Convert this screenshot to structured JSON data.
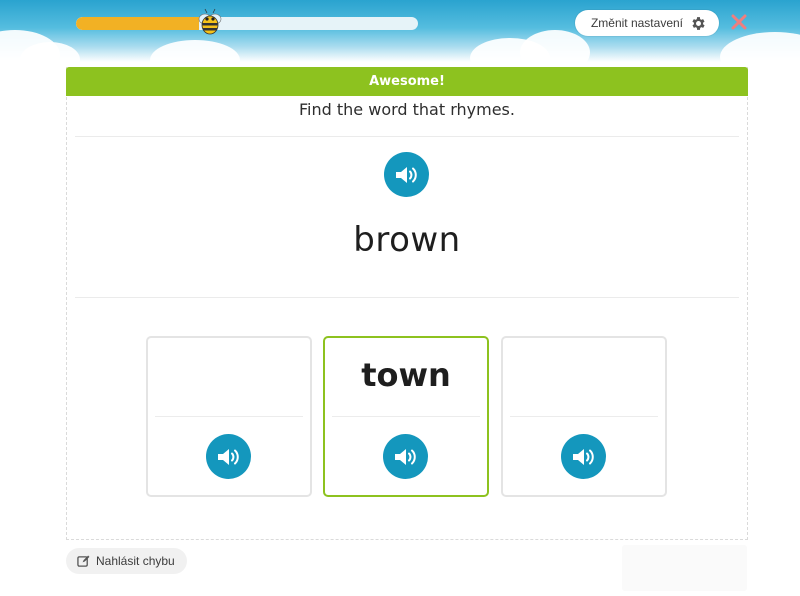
{
  "header": {
    "progress_fraction": 0.36,
    "settings_label": "Změnit nastavení",
    "colors": {
      "progress": "#f2b124",
      "sky": "#2aa3cf"
    }
  },
  "exercise": {
    "banner": "Awesome!",
    "instruction": "Find the word that rhymes.",
    "word": "brown",
    "options": [
      {
        "word": "",
        "selected": false
      },
      {
        "word": "town",
        "selected": true
      },
      {
        "word": "",
        "selected": false
      }
    ],
    "colors": {
      "banner": "#8dc21f",
      "audio": "#1497bd"
    }
  },
  "footer": {
    "report_label": "Nahlásit chybu"
  },
  "icons": [
    "bee-icon",
    "gear-icon",
    "close-icon",
    "speaker-icon",
    "edit-icon"
  ]
}
